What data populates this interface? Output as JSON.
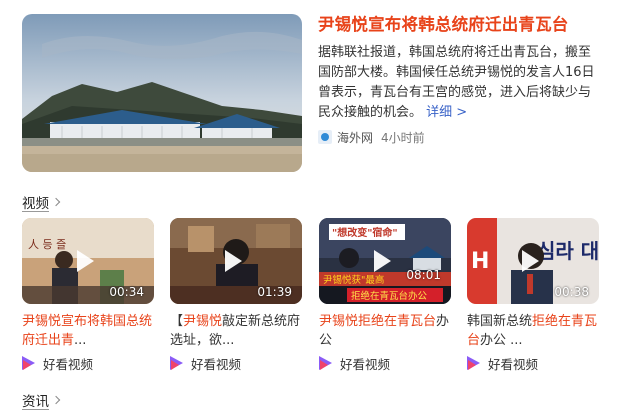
{
  "news": {
    "title": "尹锡悦宣布将韩总统府迁出青瓦台",
    "summary": "据韩联社报道，韩国总统府将迁出青瓦台，搬至国防部大楼。韩国候任总统尹锡悦的发言人16日曾表示，青瓦台有王宫的感觉，进入后将缺少与民众接触的机会。",
    "more_label": "详细 >",
    "source": "海外网",
    "time": "4小时前",
    "source_icon": "haiwai-logo-icon"
  },
  "sections": {
    "video_label": "视频",
    "news_label": "资讯"
  },
  "videos": [
    {
      "duration": "00:34",
      "title_hl": "尹锡悦宣布将韩国总统府迁出青",
      "title_rest": "...",
      "source": "好看视频"
    },
    {
      "duration": "01:39",
      "title_a": "【",
      "title_hl": "尹锡悦",
      "title_b": "敲定新总统府选址，欲...",
      "source": "好看视频"
    },
    {
      "duration": "08:01",
      "title_hl": "尹锡悦拒绝在青瓦台",
      "title_rest": "办公",
      "source": "好看视频"
    },
    {
      "duration": "00:38",
      "title_a": "韩国新总统",
      "title_hl": "拒绝在青瓦台",
      "title_b": "办公 ...",
      "source": "好看视频"
    }
  ],
  "thumb_texts": {
    "v1_sign": "人 등 즐",
    "v3_top": "\"想改变\"宿命\"",
    "v3_mid": "尹锡悦获\"最高",
    "v3_bot": "拒绝在青瓦台办公",
    "v4_sign": "심라 대",
    "v4_side": "H"
  },
  "colors": {
    "accent": "#e8431a",
    "link": "#3a63c8"
  }
}
